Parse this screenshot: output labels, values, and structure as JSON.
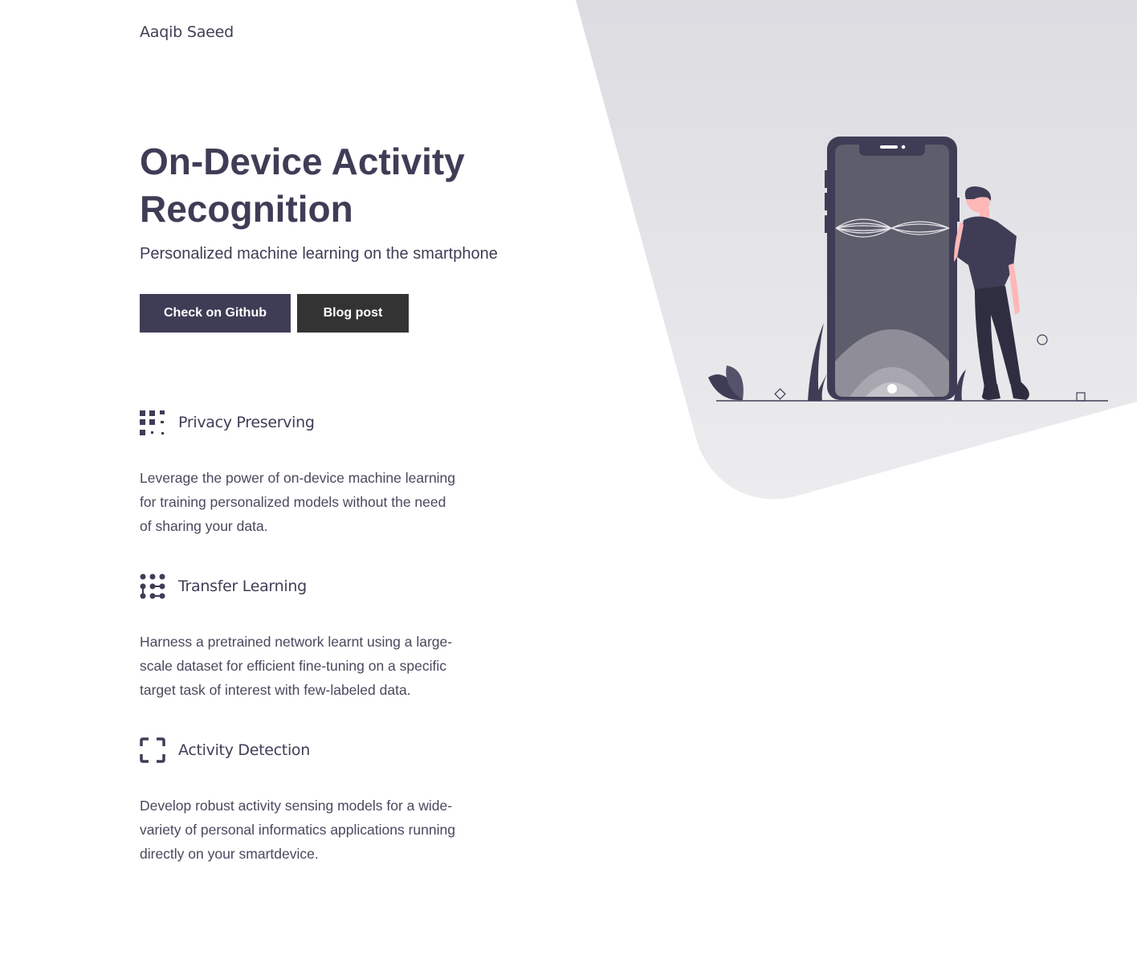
{
  "header": {
    "brand": "Aaqib Saeed"
  },
  "hero": {
    "title": "On-Device Activity Recognition",
    "subtitle": "Personalized machine learning on the smartphone",
    "buttons": {
      "github": "Check on Github",
      "blog": "Blog post"
    }
  },
  "features": [
    {
      "icon": "grid-dots-icon",
      "title": "Privacy Preserving",
      "text": "Leverage the power of on-device machine learning for training personalized models without the need of sharing your data."
    },
    {
      "icon": "network-nodes-icon",
      "title": "Transfer Learning",
      "text": "Harness a pretrained network learnt using a large-scale dataset for efficient fine-tuning on a specific target task of interest with few-labeled data."
    },
    {
      "icon": "focus-frame-icon",
      "title": "Activity Detection",
      "text": "Develop robust activity sensing models for a wide-variety of personal informatics applications running directly on your smartdevice."
    }
  ],
  "colors": {
    "primary": "#3f3d56",
    "secondary": "#333333",
    "background_shape": "#e4e4e8",
    "skin": "#ffb8b8"
  }
}
